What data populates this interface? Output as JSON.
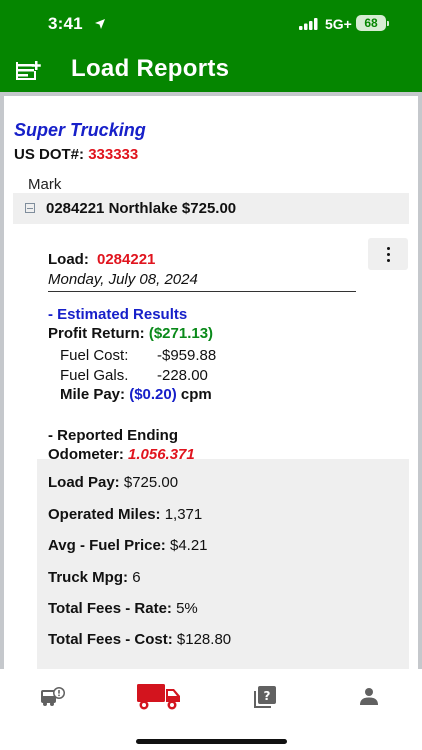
{
  "status_bar": {
    "time": "3:41",
    "network": "5G+",
    "battery": "68"
  },
  "app": {
    "title": "Load Reports"
  },
  "company": {
    "name": "Super Trucking",
    "usdot_label": "US DOT#:",
    "usdot_value": "333333"
  },
  "driver": {
    "name": "Mark"
  },
  "load_row": {
    "label": "0284221 Northlake $725.00"
  },
  "load": {
    "label": "Load:",
    "number": "0284221",
    "date": "Monday, July 08, 2024"
  },
  "estimated": {
    "heading": "- Estimated Results",
    "profit_label": "Profit Return:",
    "profit_value": "($271.13)",
    "fuel_cost_label": "Fuel Cost:",
    "fuel_cost_value": "-$959.88",
    "fuel_gals_label": "Fuel Gals.",
    "fuel_gals_value": "-228.00",
    "mile_pay_label": "Mile Pay:",
    "mile_pay_value": "($0.20)",
    "mile_pay_unit": "cpm"
  },
  "reported": {
    "heading": "- Reported Ending",
    "odometer_label": "Odometer:",
    "odometer_value": "1,056,371"
  },
  "stats": [
    {
      "label": "Load Pay:",
      "value": "$725.00"
    },
    {
      "label": "Operated Miles:",
      "value": "1,371"
    },
    {
      "label": "Avg - Fuel Price:",
      "value": "$4.21"
    },
    {
      "label": "Truck Mpg:",
      "value": "6"
    },
    {
      "label": "Total Fees - Rate:",
      "value": "5%"
    },
    {
      "label": "Total Fees - Cost:",
      "value": "$128.80"
    }
  ],
  "tabs": [
    {
      "icon": "bus-alert-icon"
    },
    {
      "icon": "truck-icon",
      "active": true
    },
    {
      "icon": "question-cards-icon"
    },
    {
      "icon": "person-icon"
    }
  ],
  "colors": {
    "header": "#058600",
    "accent_red": "#e0141e",
    "accent_blue": "#1720c9",
    "profit_green": "#0a8a1a",
    "tab_active": "#d3141e"
  }
}
